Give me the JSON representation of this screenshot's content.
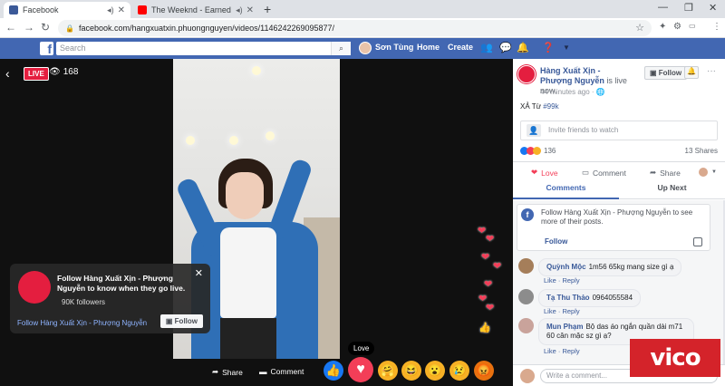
{
  "browser": {
    "tabs": [
      {
        "title": "Facebook",
        "active": true
      },
      {
        "title": "The Weeknd - Earned It (from",
        "active": false
      }
    ],
    "url": "facebook.com/hangxuatxin.phuongnguyen/videos/1146242269095877/"
  },
  "fb": {
    "search_placeholder": "Search",
    "user_name": "Sơn Tùng",
    "nav_home": "Home",
    "nav_create": "Create",
    "brand_color": "#4267b2"
  },
  "video": {
    "live_label": "LIVE",
    "viewers": "168",
    "follow_card": {
      "message": "Follow Hàng Xuất Xịn - Phượng Nguyễn to know when they go live.",
      "followers": "90K followers",
      "page_link": "Follow Hàng Xuất Xịn - Phượng Nguyễn",
      "button": "Follow"
    },
    "share_label": "Share",
    "comment_label": "Comment",
    "tooltip": "Love"
  },
  "panel": {
    "page_name": "Hàng Xuất Xịn - Phượng Nguyễn",
    "status": "is live now.",
    "time": "44 minutes ago ·",
    "follow_button": "Follow",
    "caption_text": "XẢ Từ",
    "caption_tag": "#99k",
    "invite": "Invite friends to watch",
    "reaction_count": "136",
    "shares": "13 Shares",
    "actions": {
      "love": "Love",
      "comment": "Comment",
      "share": "Share"
    },
    "tabs": {
      "comments": "Comments",
      "upnext": "Up Next"
    },
    "notice": {
      "text": "Follow Hàng Xuất Xịn - Phượng Nguyễn to see more of their posts.",
      "follow": "Follow"
    },
    "comments": [
      {
        "author": "Quỳnh Mộc",
        "text": "1m56 65kg mang size gì ạ",
        "like": "Like",
        "reply": "Reply"
      },
      {
        "author": "Tạ Thu Thảo",
        "text": "0964055584",
        "like": "Like",
        "reply": "Reply"
      },
      {
        "author": "Mun Phạm",
        "text": "Bộ das áo ngắn quần dài m71 60 cân mặc sz gì ạ?",
        "like": "Like",
        "reply": "Reply"
      }
    ],
    "compose_placeholder": "Write a comment..."
  },
  "watermark": "vico"
}
